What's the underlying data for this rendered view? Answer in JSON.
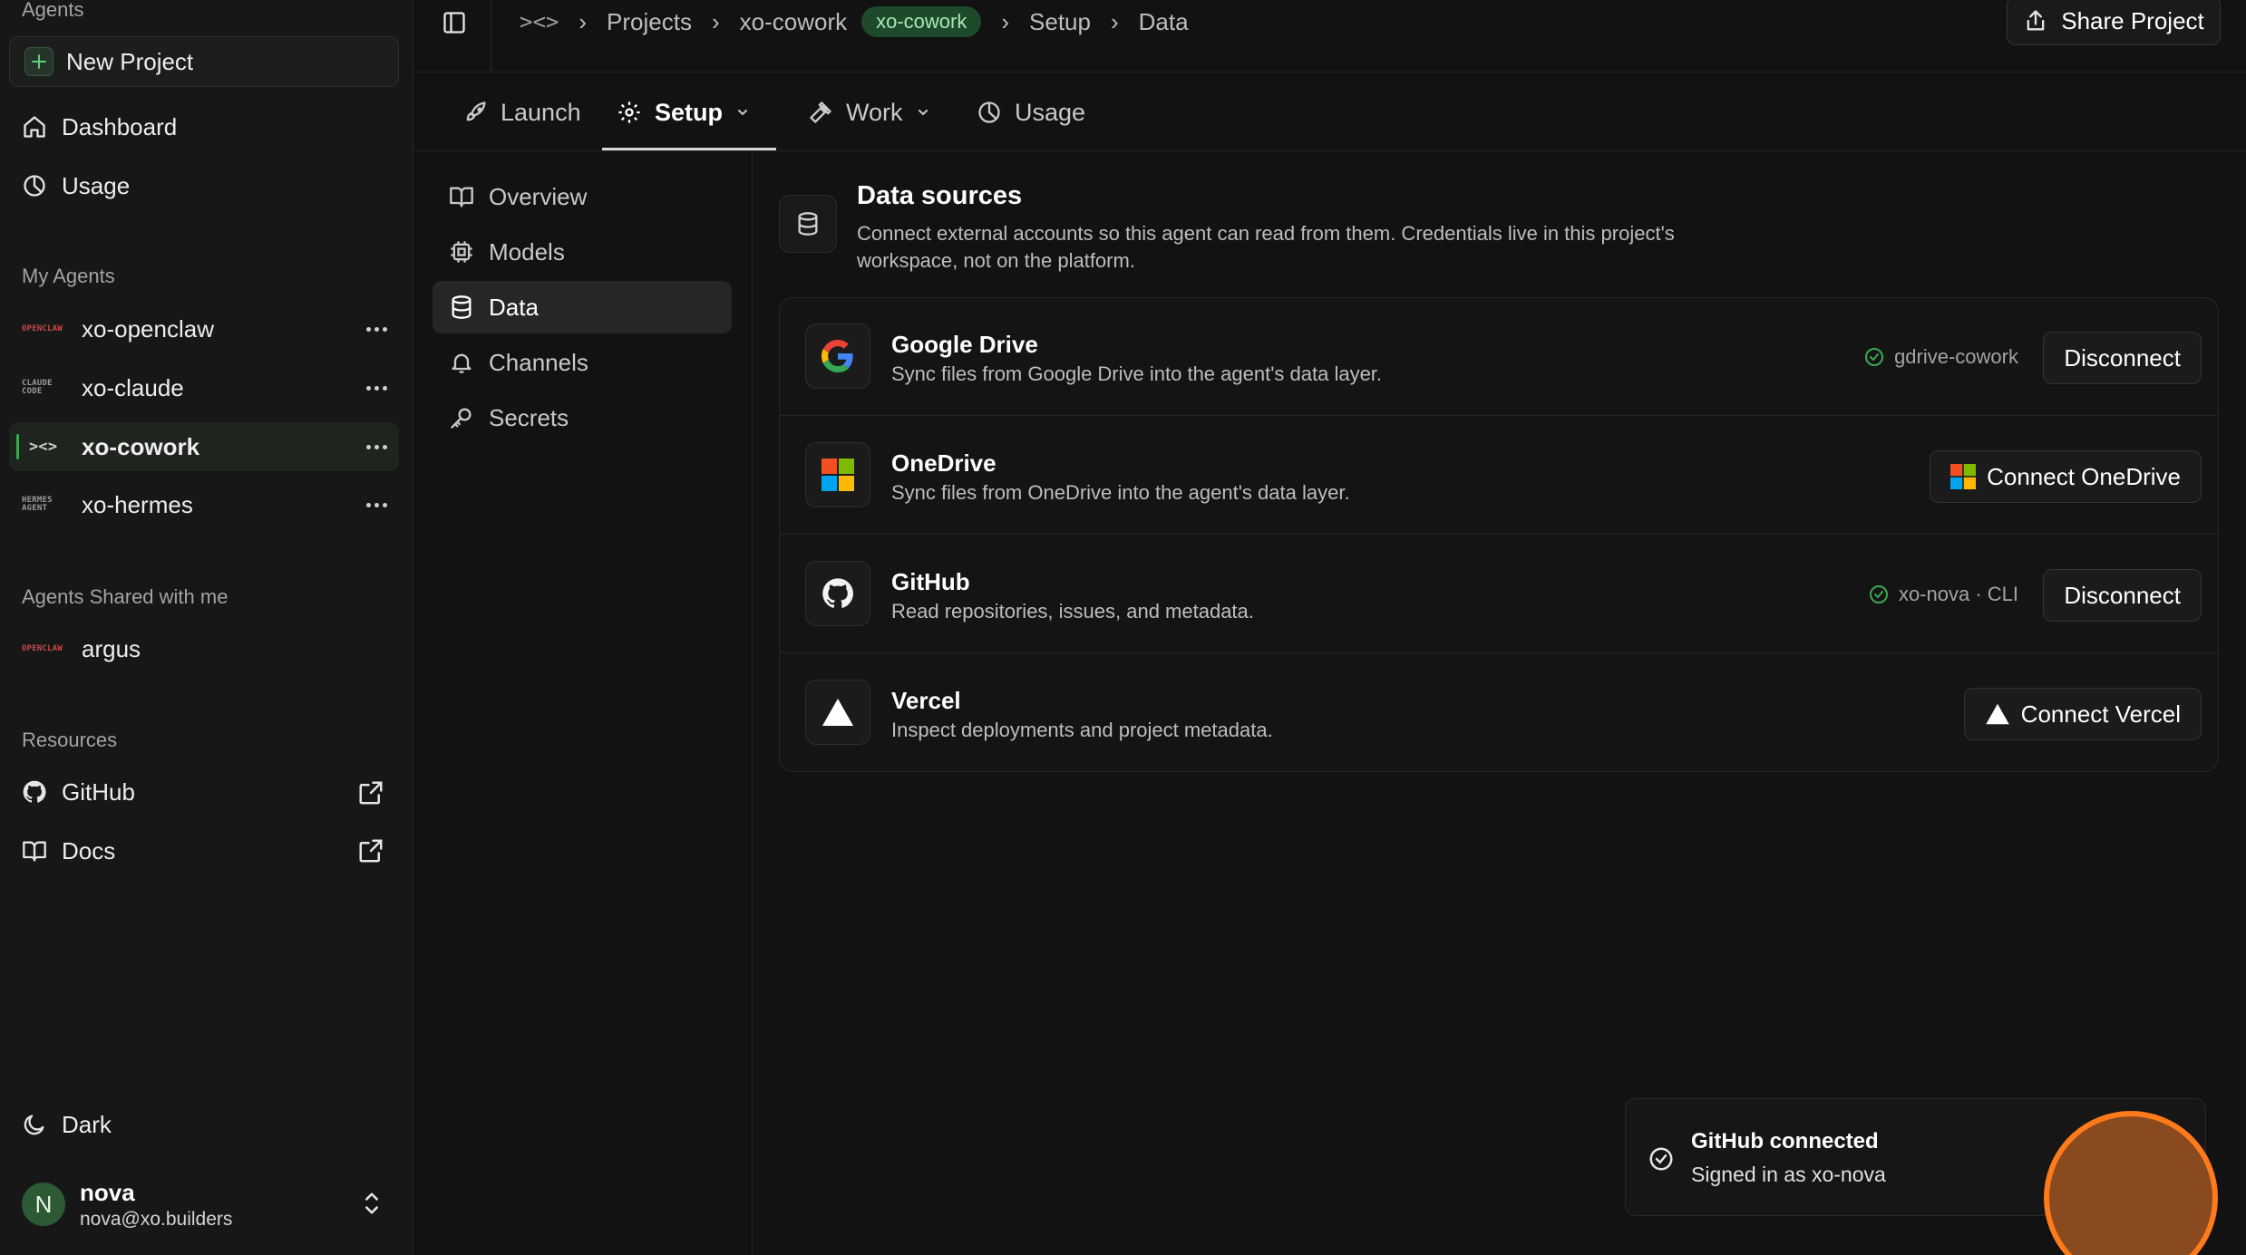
{
  "sidebar": {
    "agents_label": "Agents",
    "new_project_label": "New Project",
    "nav": [
      {
        "label": "Dashboard",
        "icon": "home-icon"
      },
      {
        "label": "Usage",
        "icon": "pie-chart-icon"
      }
    ],
    "my_agents_label": "My Agents",
    "my_agents": [
      {
        "name": "xo-openclaw",
        "logo_text": "OPENCLAW",
        "active": false
      },
      {
        "name": "xo-claude",
        "logo_text": "CLAUDE CODE",
        "active": false
      },
      {
        "name": "xo-cowork",
        "logo_text": "><>",
        "active": true
      },
      {
        "name": "xo-hermes",
        "logo_text": "HERMES AGENT",
        "active": false
      }
    ],
    "shared_label": "Agents Shared with me",
    "shared_agents": [
      {
        "name": "argus",
        "logo_text": "OPENCLAW"
      }
    ],
    "resources_label": "Resources",
    "resources": [
      {
        "label": "GitHub",
        "icon": "github-icon"
      },
      {
        "label": "Docs",
        "icon": "book-icon"
      }
    ],
    "theme_label": "Dark",
    "user": {
      "initial": "N",
      "name": "nova",
      "email": "nova@xo.builders"
    }
  },
  "breadcrumb": {
    "logo": "><>",
    "items": [
      "Projects",
      "xo-cowork"
    ],
    "pill": "xo-cowork",
    "tail": [
      "Setup",
      "Data"
    ]
  },
  "share_label": "Share Project",
  "tabs": [
    {
      "label": "Launch",
      "icon": "rocket-icon",
      "dropdown": false,
      "active": false
    },
    {
      "label": "Setup",
      "icon": "gear-icon",
      "dropdown": true,
      "active": true
    },
    {
      "label": "Work",
      "icon": "hammer-icon",
      "dropdown": true,
      "active": false
    },
    {
      "label": "Usage",
      "icon": "pie-chart-icon",
      "dropdown": false,
      "active": false
    }
  ],
  "subnav": [
    {
      "label": "Overview",
      "icon": "book-icon",
      "active": false
    },
    {
      "label": "Models",
      "icon": "chip-icon",
      "active": false
    },
    {
      "label": "Data",
      "icon": "database-icon",
      "active": true
    },
    {
      "label": "Channels",
      "icon": "bell-icon",
      "active": false
    },
    {
      "label": "Secrets",
      "icon": "key-icon",
      "active": false
    }
  ],
  "data_sources": {
    "title": "Data sources",
    "description": "Connect external accounts so this agent can read from them. Credentials live in this project's workspace, not on the platform.",
    "items": [
      {
        "name": "Google Drive",
        "description": "Sync files from Google Drive into the agent's data layer.",
        "status": "gdrive-cowork",
        "action": "Disconnect",
        "connected": true
      },
      {
        "name": "OneDrive",
        "description": "Sync files from OneDrive into the agent's data layer.",
        "status": "",
        "action": "Connect OneDrive",
        "connected": false
      },
      {
        "name": "GitHub",
        "description": "Read repositories, issues, and metadata.",
        "status": "xo-nova · CLI",
        "action": "Disconnect",
        "connected": true
      },
      {
        "name": "Vercel",
        "description": "Inspect deployments and project metadata.",
        "status": "",
        "action": "Connect Vercel",
        "connected": false
      }
    ]
  },
  "toast": {
    "title": "GitHub connected",
    "subtitle": "Signed in as xo-nova"
  },
  "colors": {
    "accent_green": "#3aa84f",
    "pill_bg": "#1d4a2a",
    "cursor_orange": "#ff7a1a"
  }
}
